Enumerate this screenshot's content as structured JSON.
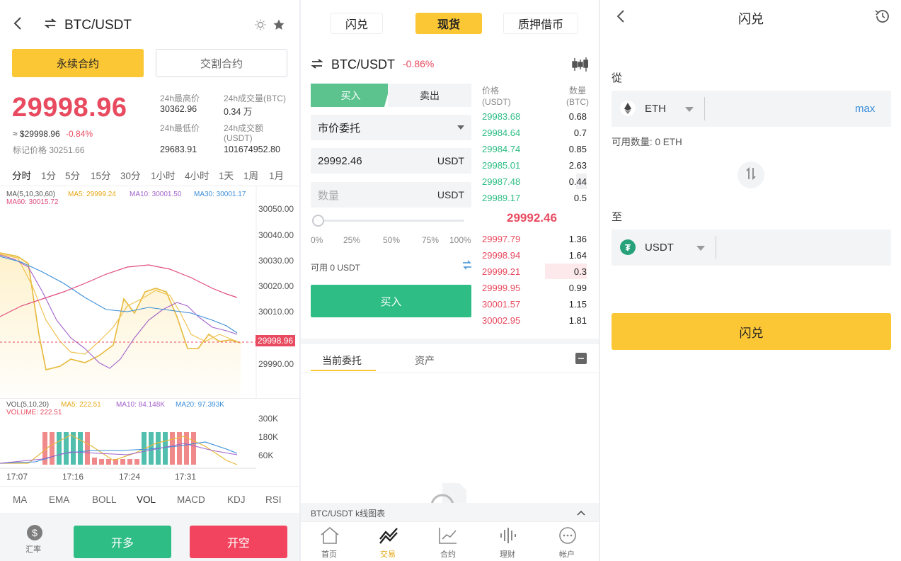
{
  "colors": {
    "yellow": "#fbc735",
    "green": "#2ebd85",
    "red": "#e84a5f",
    "gray_bg": "#f3f4f6"
  },
  "p1": {
    "pair": "BTC/USDT",
    "tabs": [
      "永续合约",
      "交割合约"
    ],
    "last_price": "29998.96",
    "approx": "≈ $29998.96",
    "change": "-0.84%",
    "mark_price": "标记价格 30251.66",
    "stats": {
      "high_label": "24h最高价",
      "high_value": "30362.96",
      "vol_btc_label": "24h成交量(BTC)",
      "vol_btc_value": "0.34 万",
      "low_label": "24h最低价",
      "low_value": "29683.91",
      "vol_usdt_label": "24h成交额",
      "vol_usdt_label2": "(USDT)",
      "vol_usdt_value": "101674952.80"
    },
    "timeframes": [
      "分时",
      "1分",
      "5分",
      "15分",
      "30分",
      "1小时",
      "4小时",
      "1天",
      "1周",
      "1月"
    ],
    "legend": {
      "ma": "MA(5,10,30,60)",
      "ma5": "MA5: 29999.24",
      "ma10": "MA10: 30001.50",
      "ma30": "MA30: 30001.17",
      "ma60": "MA60: 30015.72",
      "vol": "VOL(5,10,20)",
      "vma5": "MA5: 222.51",
      "vma10": "MA10: 84.148K",
      "vma20": "MA20: 97.393K",
      "volume": "VOLUME: 222.51"
    },
    "price_axis": [
      "30050.00",
      "30040.00",
      "30030.00",
      "30020.00",
      "30010.00",
      "29990.00"
    ],
    "current_tag": "29998.96",
    "vol_axis": [
      "300K",
      "180K",
      "60K"
    ],
    "time_axis": [
      "17:07",
      "17:16",
      "17:24",
      "17:31"
    ],
    "indicators": [
      "MA",
      "EMA",
      "BOLL",
      "VOL",
      "MACD",
      "KDJ",
      "RSI"
    ],
    "rate_label": "汇率",
    "long_btn": "开多",
    "short_btn": "开空"
  },
  "p2": {
    "top_tabs": [
      "闪兑",
      "现货",
      "质押借币"
    ],
    "pair": "BTC/USDT",
    "change": "-0.86%",
    "buy_tab": "买入",
    "sell_tab": "卖出",
    "order_type": "市价委托",
    "price_value": "29992.46",
    "unit": "USDT",
    "qty_placeholder": "数量",
    "percents": [
      "0%",
      "25%",
      "50%",
      "75%",
      "100%"
    ],
    "available": "可用 0 USDT",
    "buy_btn": "买入",
    "ob_head": {
      "price": "价格",
      "price_unit": "(USDT)",
      "qty": "数量",
      "qty_unit": "(BTC)"
    },
    "bids": [
      {
        "p": "29983.68",
        "q": "0.68"
      },
      {
        "p": "29984.64",
        "q": "0.7"
      },
      {
        "p": "29984.74",
        "q": "0.85"
      },
      {
        "p": "29985.01",
        "q": "2.63"
      },
      {
        "p": "29987.48",
        "q": "0.44"
      },
      {
        "p": "29989.17",
        "q": "0.5"
      }
    ],
    "mid_price": "29992.46",
    "asks": [
      {
        "p": "29997.79",
        "q": "1.36"
      },
      {
        "p": "29998.94",
        "q": "1.64"
      },
      {
        "p": "29999.21",
        "q": "0.3"
      },
      {
        "p": "29999.95",
        "q": "0.99"
      },
      {
        "p": "30001.57",
        "q": "1.15"
      },
      {
        "p": "30002.95",
        "q": "1.81"
      }
    ],
    "orders_tabs": [
      "当前委托",
      "资产"
    ],
    "kline_label": "BTC/USDT k线图表",
    "nav": [
      "首页",
      "交易",
      "合约",
      "理财",
      "帐户"
    ]
  },
  "p3": {
    "title": "闪兑",
    "from_label": "從",
    "from_coin": "ETH",
    "max": "max",
    "available": "可用数量: 0 ETH",
    "to_label": "至",
    "to_coin": "USDT",
    "submit": "闪兑"
  }
}
